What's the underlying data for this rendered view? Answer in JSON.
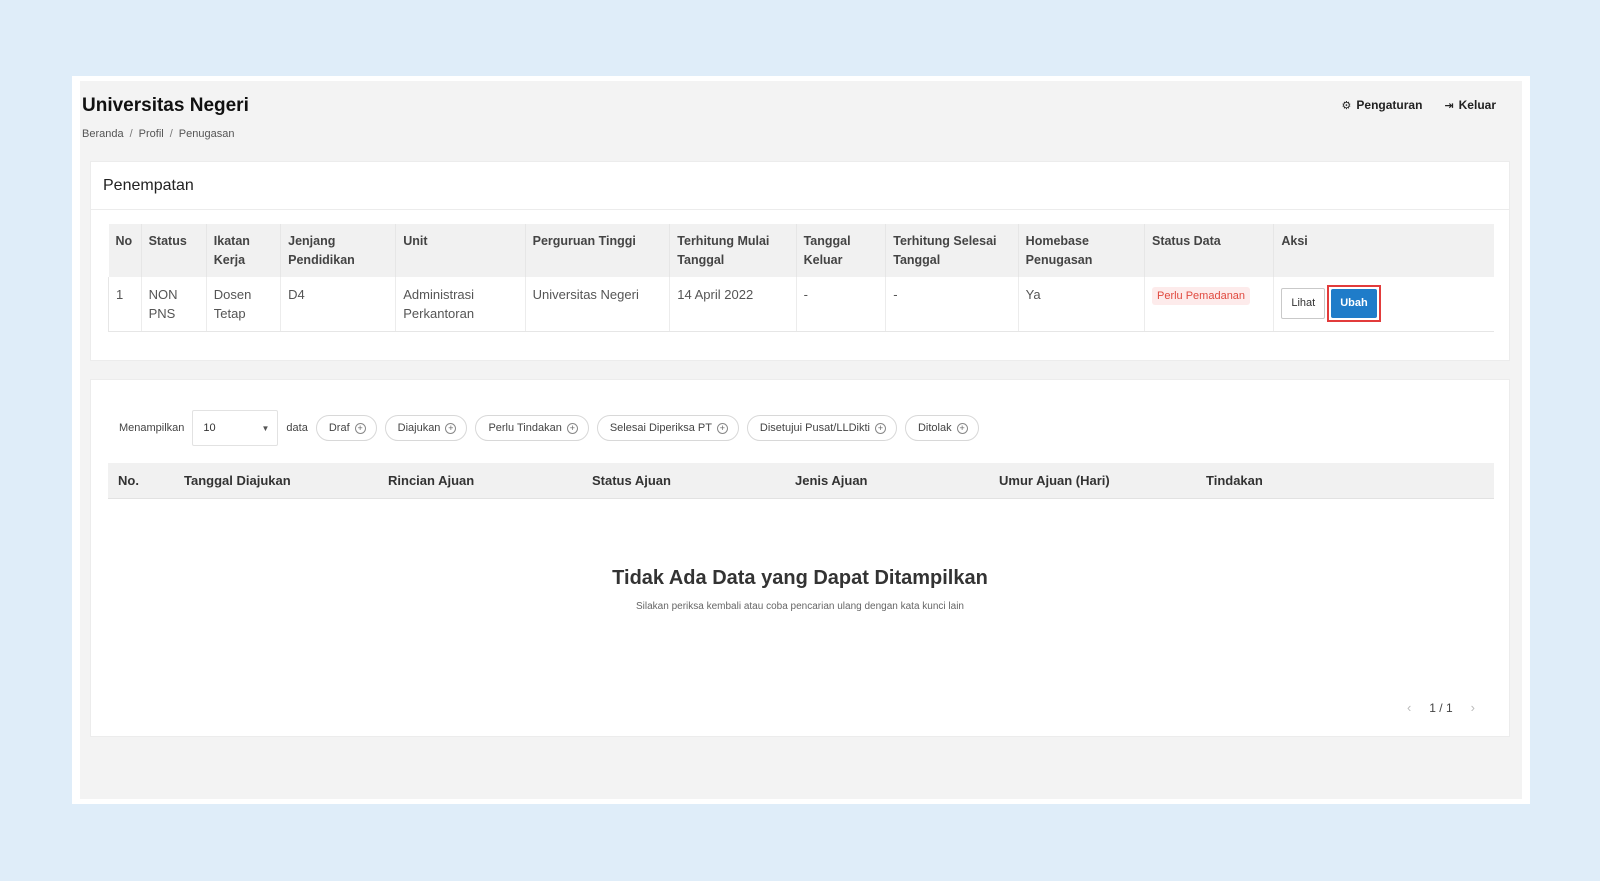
{
  "header": {
    "title": "Universitas Negeri",
    "breadcrumb": [
      "Beranda",
      "Profil",
      "Penugasan"
    ],
    "settings_label": "Pengaturan",
    "settings_icon": "gear-icon",
    "logout_label": "Keluar",
    "logout_icon": "sign-out-icon"
  },
  "placement": {
    "title": "Penempatan",
    "columns": [
      "No",
      "Status",
      "Ikatan Kerja",
      "Jenjang Pendidikan",
      "Unit",
      "Perguruan Tinggi",
      "Terhitung Mulai Tanggal",
      "Tanggal Keluar",
      "Terhitung Selesai Tanggal",
      "Homebase Penugasan",
      "Status Data",
      "Aksi"
    ],
    "rows": [
      {
        "no": "1",
        "status": "NON PNS",
        "ikatan_kerja": "Dosen Tetap",
        "jenjang": "D4",
        "unit": "Administrasi Perkantoran",
        "perguruan_tinggi": "Universitas Negeri",
        "mulai": "14 April 2022",
        "keluar": "-",
        "selesai": "-",
        "homebase": "Ya",
        "status_data": "Perlu Pemadanan",
        "view_label": "Lihat",
        "edit_label": "Ubah"
      }
    ]
  },
  "submissions": {
    "show_label": "Menampilkan",
    "page_size": "10",
    "data_label": "data",
    "filters": [
      "Draf",
      "Diajukan",
      "Perlu Tindakan",
      "Selesai Diperiksa PT",
      "Disetujui Pusat/LLDikti",
      "Ditolak"
    ],
    "columns": [
      "No.",
      "Tanggal Diajukan",
      "Rincian Ajuan",
      "Status Ajuan",
      "Jenis Ajuan",
      "Umur Ajuan (Hari)",
      "Tindakan"
    ],
    "empty_title": "Tidak Ada Data yang Dapat Ditampilkan",
    "empty_subtitle": "Silakan periksa kembali atau coba pencarian ulang dengan kata kunci lain",
    "pagination": "1 / 1"
  },
  "colors": {
    "background": "#dfedf9",
    "primary_button": "#1f7cc9",
    "highlight_border": "#e23b3b",
    "warning_text": "#e0493f"
  }
}
